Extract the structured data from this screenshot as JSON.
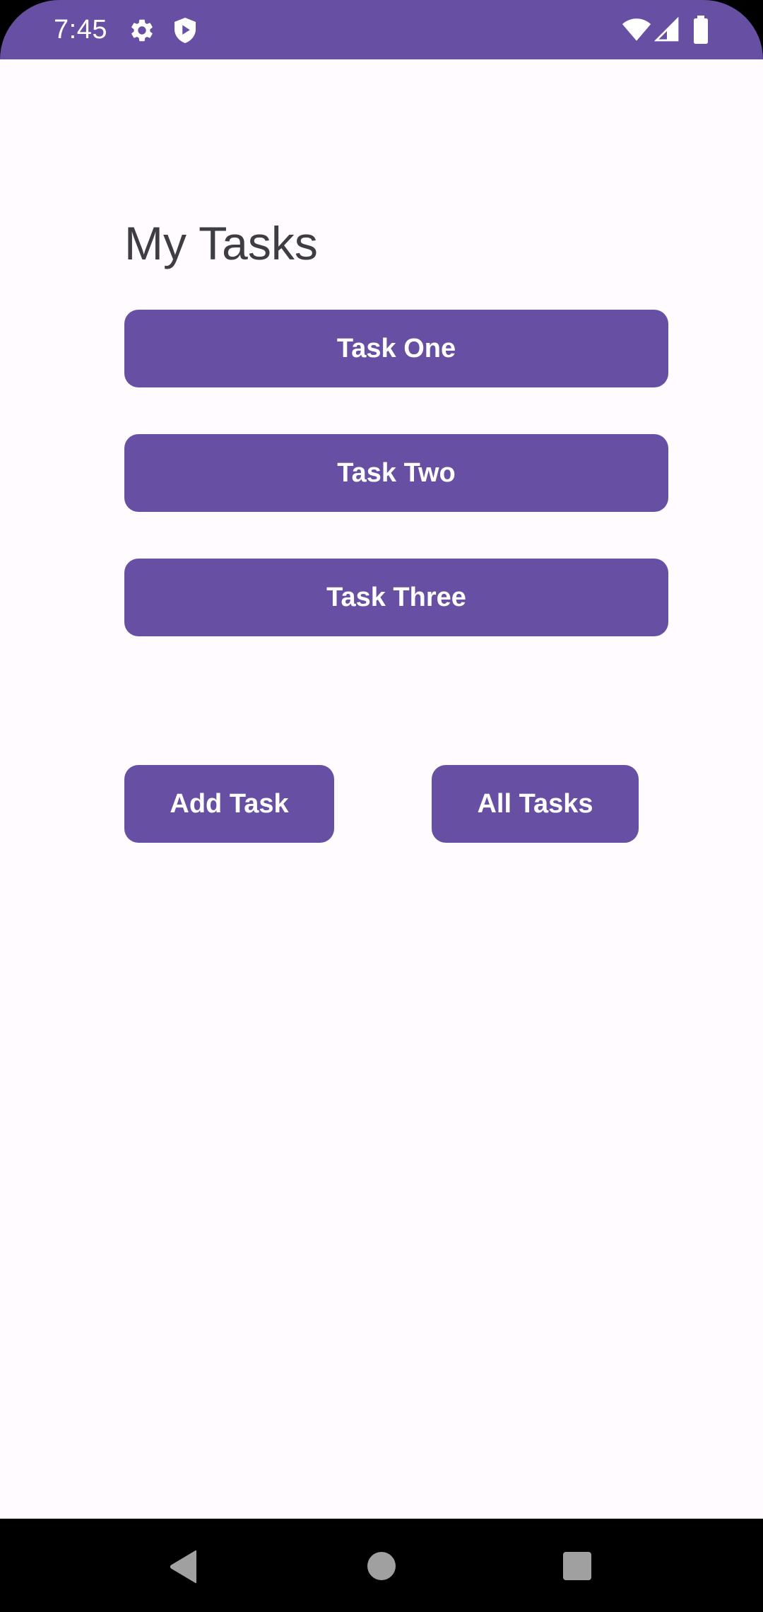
{
  "status_bar": {
    "time": "7:45",
    "color": "#6750A4",
    "icons": [
      "settings-gear-icon",
      "play-shield-icon",
      "wifi-icon",
      "cellular-signal-icon",
      "battery-icon"
    ]
  },
  "main": {
    "title": "My Tasks",
    "tasks": [
      {
        "label": "Task One"
      },
      {
        "label": "Task Two"
      },
      {
        "label": "Task Three"
      }
    ],
    "actions": {
      "add_task_label": "Add Task",
      "all_tasks_label": "All Tasks"
    },
    "accent_color": "#6750A4",
    "background_color": "#FFFBFE"
  },
  "nav_bar": {
    "buttons": [
      "back-icon",
      "home-icon",
      "recents-icon"
    ]
  }
}
